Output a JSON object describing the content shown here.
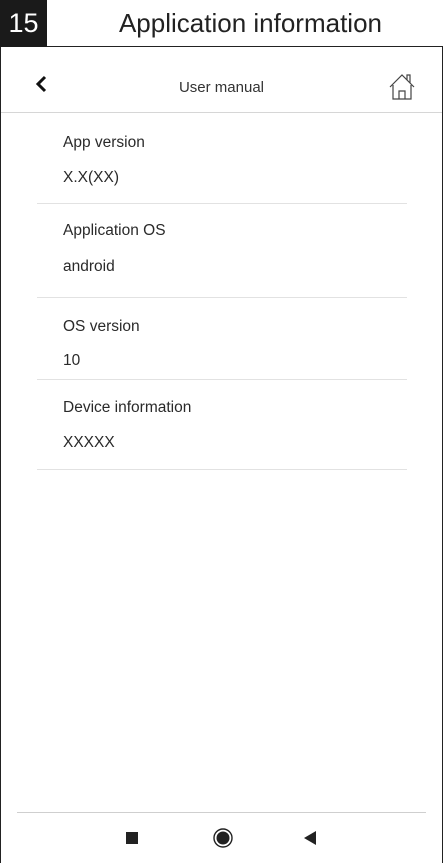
{
  "header": {
    "page_number": "15",
    "title": "Application information"
  },
  "nav": {
    "title": "User manual",
    "back_icon": "chevron-left-icon",
    "home_icon": "home-icon"
  },
  "info_items": [
    {
      "label": "App version",
      "value": "X.X(XX)"
    },
    {
      "label": "Application OS",
      "value": "android"
    },
    {
      "label": "OS version",
      "value": "10"
    },
    {
      "label": "Device information",
      "value": "XXXXX"
    }
  ],
  "system_nav": {
    "recent_icon": "square-icon",
    "home_icon": "circle-icon",
    "back_icon": "triangle-back-icon"
  },
  "colors": {
    "page_number_bg": "#1a1a1a",
    "text": "#2a2a2a",
    "divider": "#e2e2e2"
  }
}
